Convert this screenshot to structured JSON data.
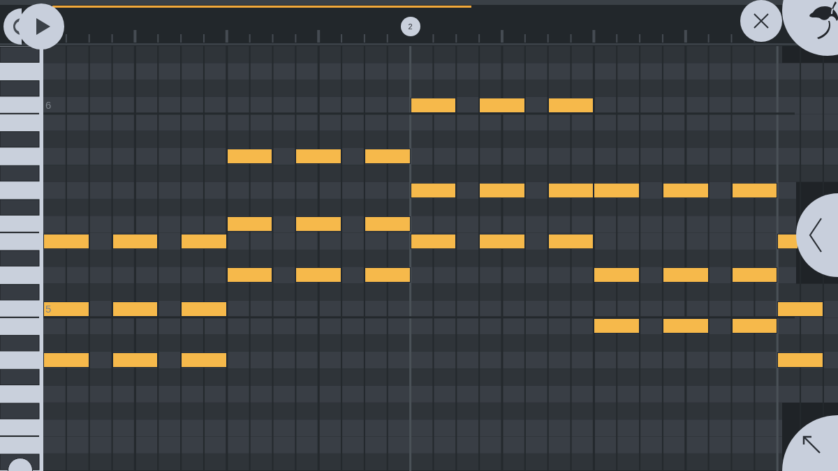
{
  "timeline": {
    "bar_markers": [
      {
        "text": "2"
      }
    ]
  },
  "piano_roll": {
    "octave_labels": [
      {
        "text": "6"
      },
      {
        "text": "5"
      }
    ]
  }
}
